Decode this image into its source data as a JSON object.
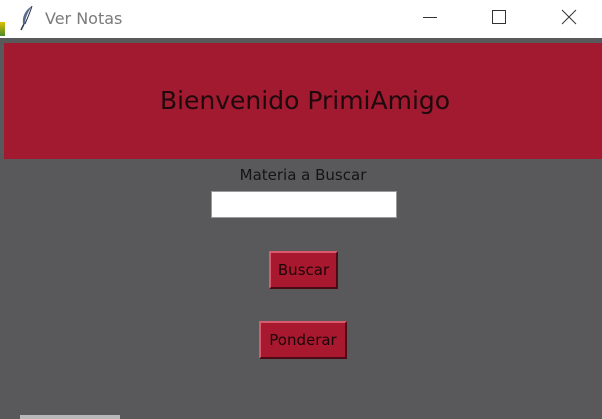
{
  "window": {
    "title": "Ver Notas",
    "icon": "feather-icon",
    "controls": {
      "minimize_icon": "minimize-icon",
      "maximize_icon": "maximize-icon",
      "close_icon": "close-icon"
    }
  },
  "banner": {
    "welcome_text": "Bienvenido PrimiAmigo",
    "background_color": "#a11a30"
  },
  "form": {
    "search_label": "Materia a Buscar",
    "search_value": "",
    "search_placeholder": ""
  },
  "buttons": {
    "search_label": "Buscar",
    "weigh_label": "Ponderar",
    "color": "#a8192f"
  },
  "theme": {
    "body_background": "#59595b"
  }
}
